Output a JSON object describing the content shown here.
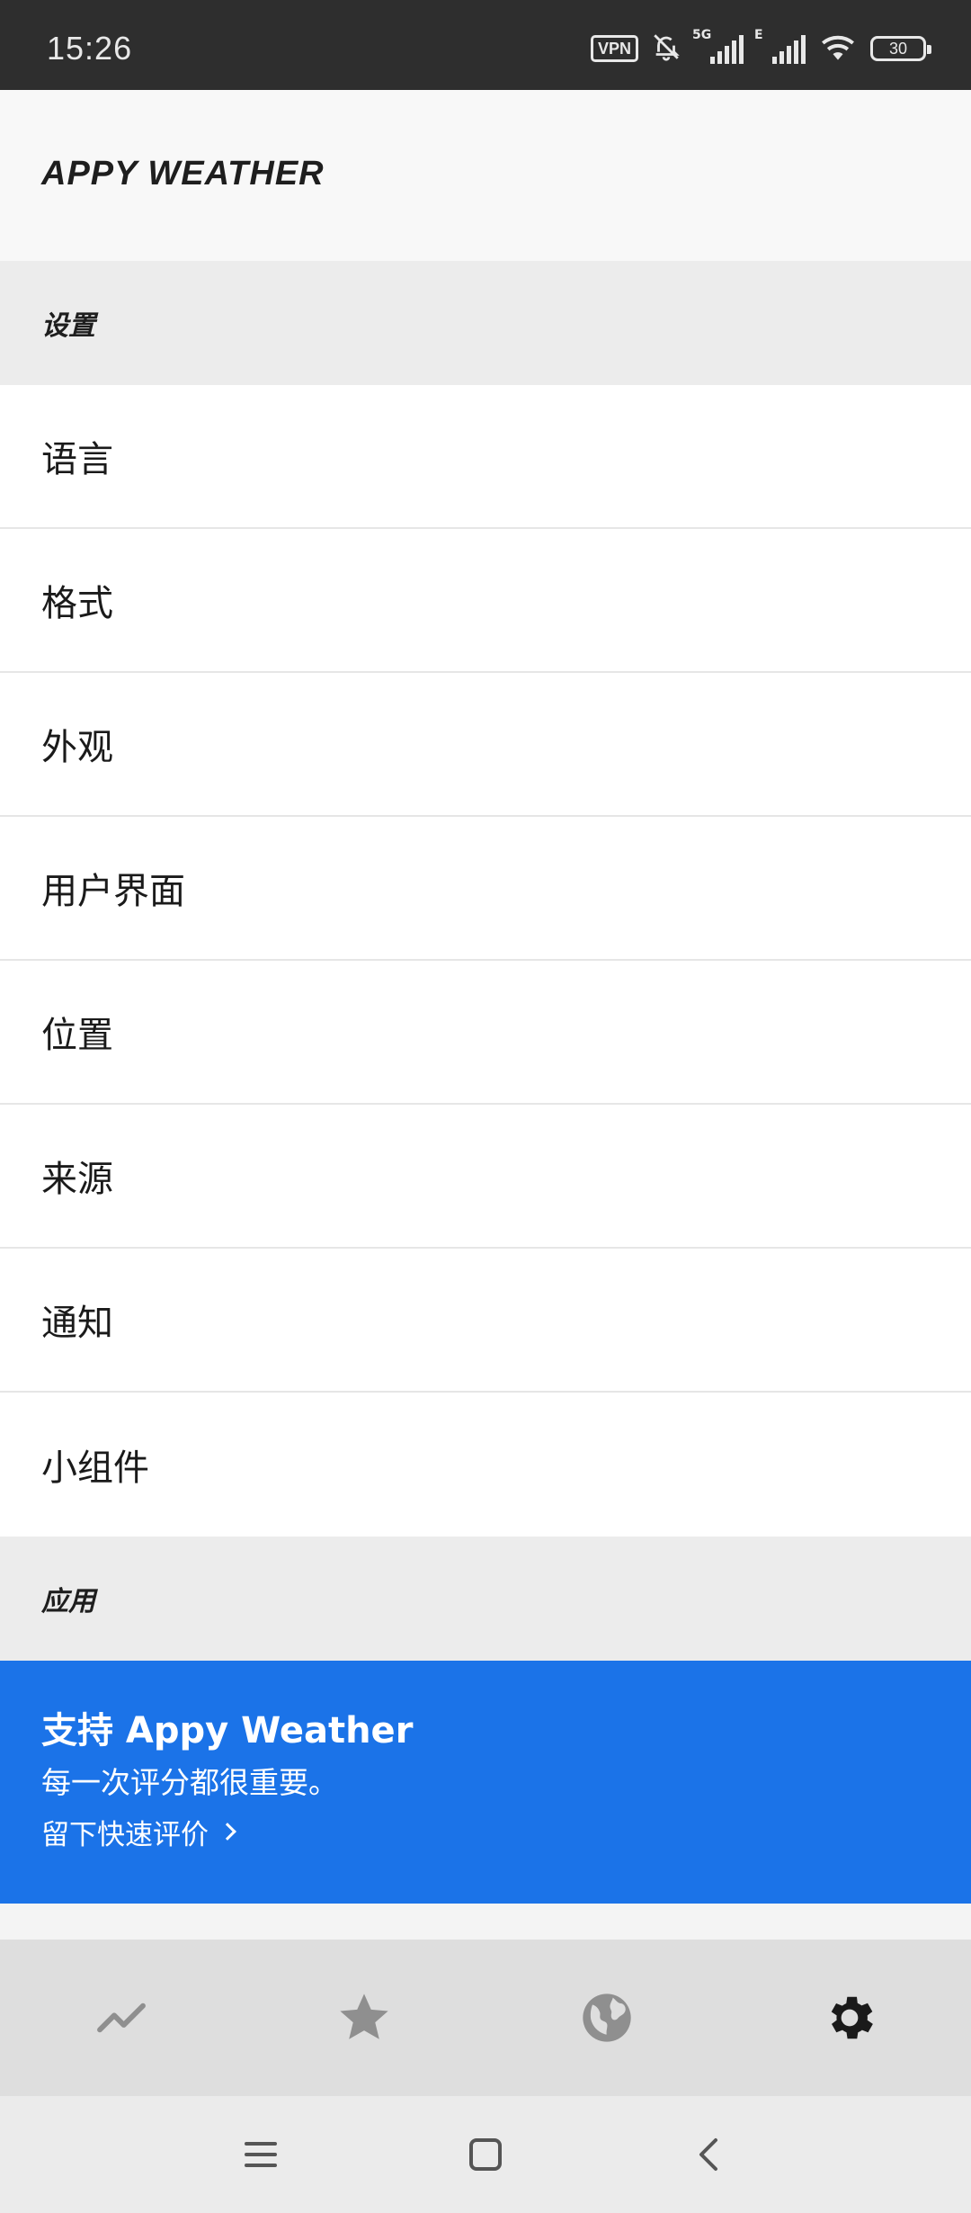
{
  "status_bar": {
    "time": "15:26",
    "vpn_label": "VPN",
    "signal1_label": "5G",
    "signal2_label": "E",
    "battery_level": "30"
  },
  "header": {
    "title": "APPY WEATHER"
  },
  "sections": {
    "settings_title": "设置",
    "app_title": "应用"
  },
  "menu": {
    "items": [
      {
        "label": "语言"
      },
      {
        "label": "格式"
      },
      {
        "label": "外观"
      },
      {
        "label": "用户界面"
      },
      {
        "label": "位置"
      },
      {
        "label": "来源"
      },
      {
        "label": "通知"
      },
      {
        "label": "小组件"
      }
    ]
  },
  "support": {
    "title": "支持 Appy Weather",
    "subtitle": "每一次评分都很重要。",
    "link": "留下快速评价"
  },
  "bottom_nav": {
    "tabs": [
      {
        "icon": "trend-icon",
        "active": false
      },
      {
        "icon": "star-icon",
        "active": false
      },
      {
        "icon": "globe-icon",
        "active": false
      },
      {
        "icon": "gear-icon",
        "active": true
      }
    ]
  },
  "colors": {
    "accent": "#1b73e8",
    "status_bar": "#2e2e2e",
    "inactive_icon": "#8f8f8f",
    "active_icon": "#1a1a1a"
  }
}
